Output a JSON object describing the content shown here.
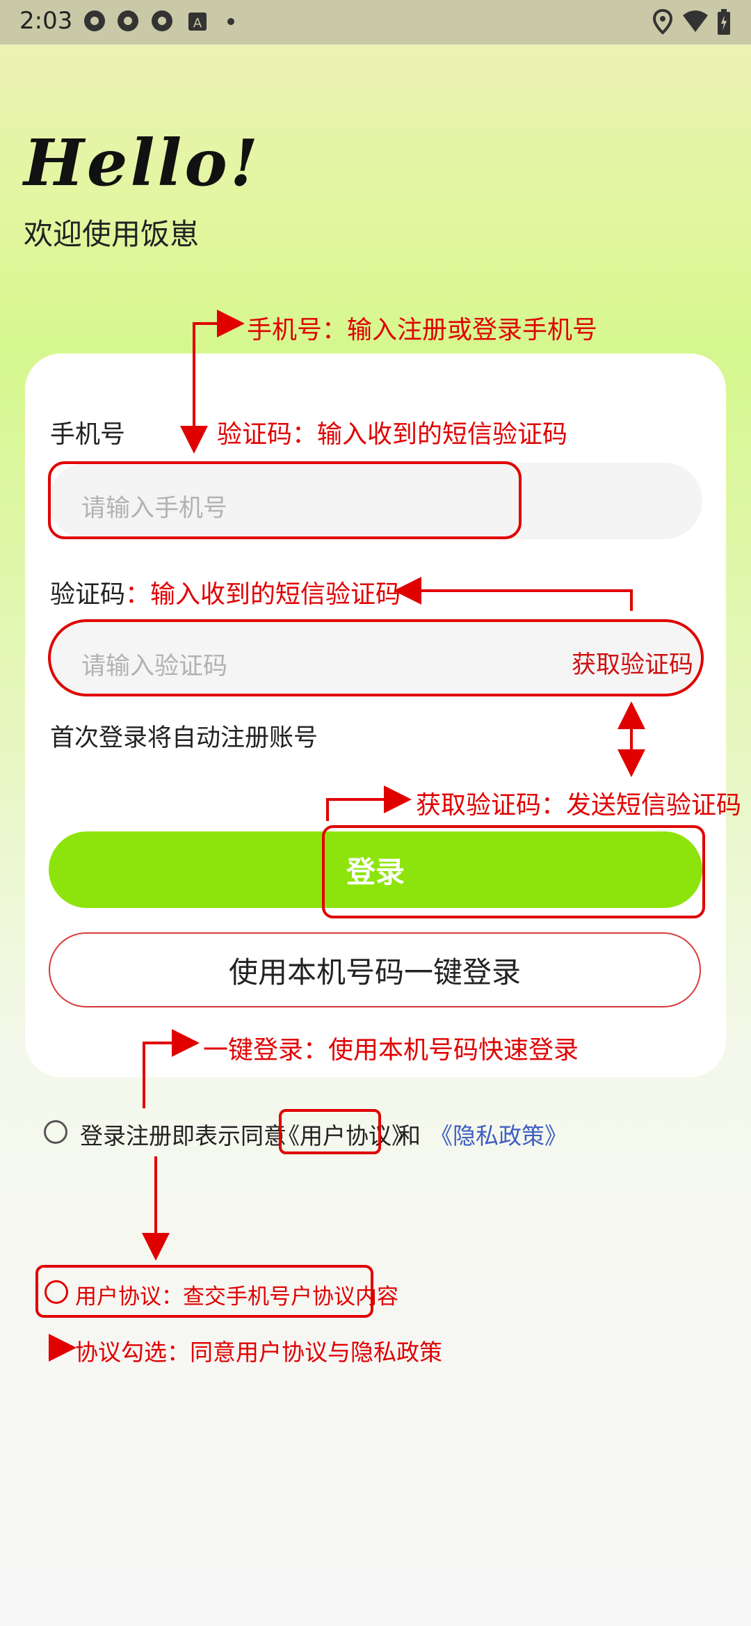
{
  "status_bar": {
    "time": "2:03"
  },
  "header": {
    "greeting": "Hello!",
    "welcome": "欢迎使用饭崽"
  },
  "form": {
    "phone_label": "手机号",
    "phone_placeholder": "请输入手机号",
    "code_label": "验证码",
    "code_placeholder": "请输入验证码",
    "get_code_label": "获取验证码",
    "auto_register_note": "首次登录将自动注册账号",
    "login_label": "登录",
    "one_key_login_label": "使用本机号码一键登录"
  },
  "agreement": {
    "prefix": "登录注册即表示同意",
    "user_agreement": "《用户协议》",
    "and": "和",
    "privacy_policy": "《隐私政策》"
  },
  "annotations": {
    "phone": "手机号：输入注册或登录手机号",
    "code_top": "验证码：输入收到的短信验证码",
    "code_colon": "：",
    "code_desc": "输入收到的短信验证码",
    "get_code": "获取验证码：发送短信验证码",
    "one_key": "一键登录：使用本机号码快速登录",
    "user_agreement": "用户协议：查交手机号户协议内容",
    "checkbox": "协议勾选：同意用户协议与隐私政策"
  },
  "colors": {
    "accent_green": "#8de40d",
    "annotation_red": "#e00000",
    "link_blue": "#3f5fc2"
  }
}
